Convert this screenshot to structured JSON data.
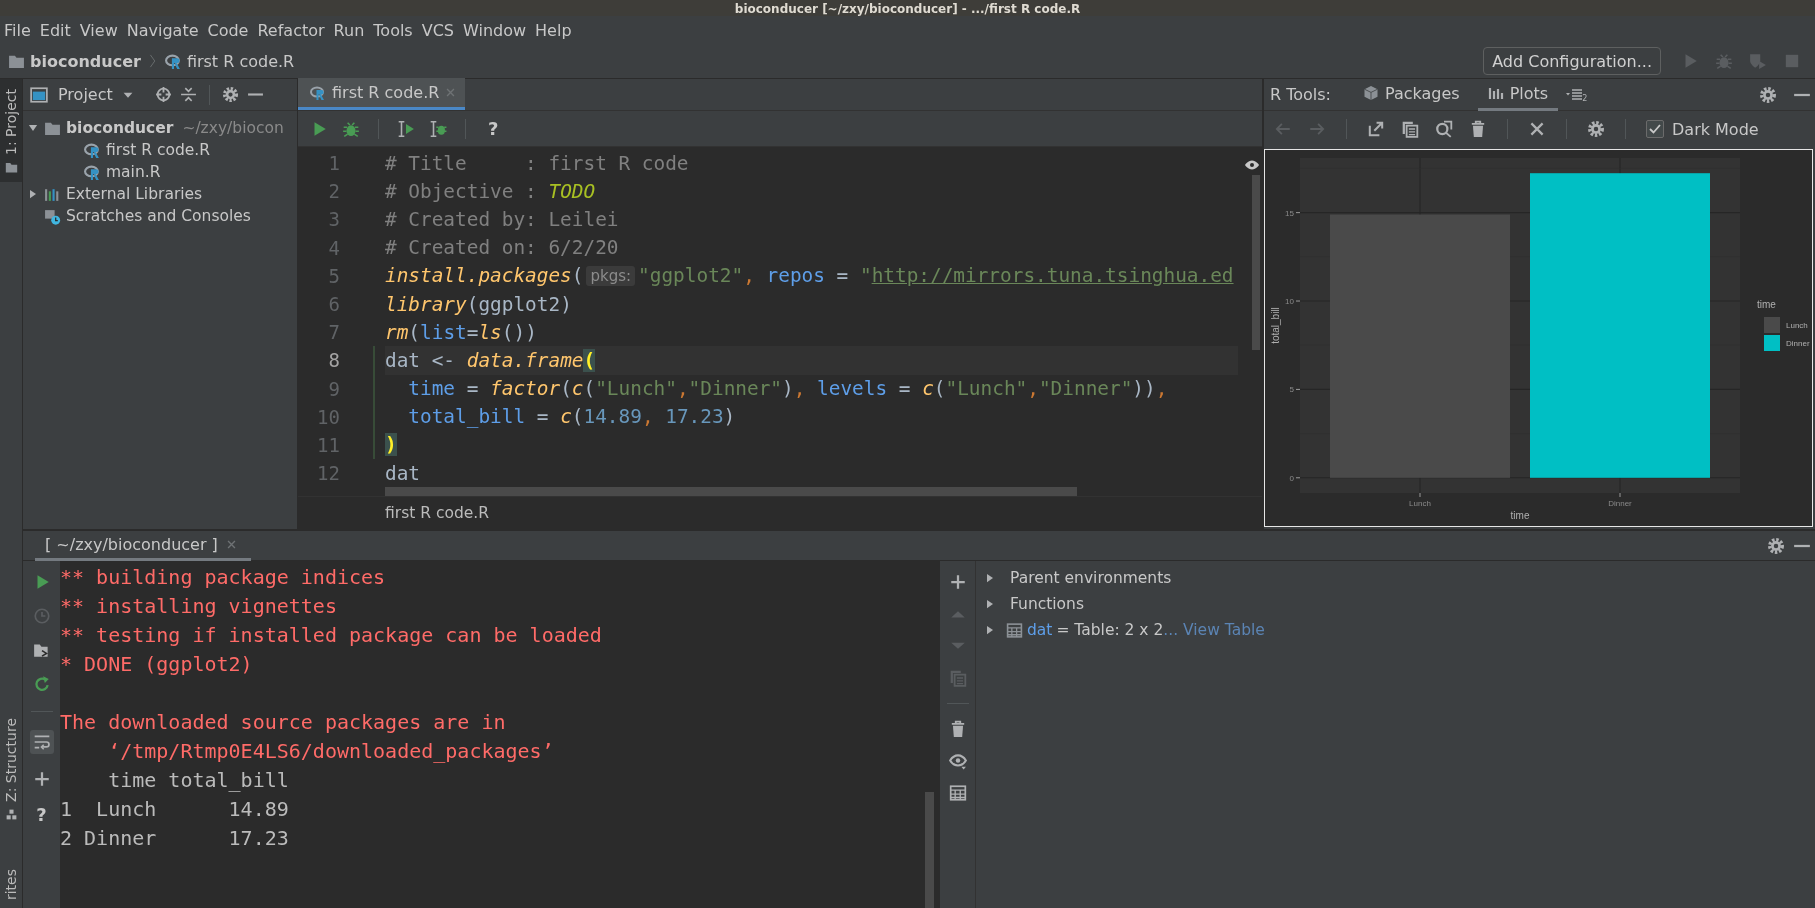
{
  "window": {
    "title": "bioconducer [~/zxy/bioconducer] - .../first R code.R"
  },
  "menu": [
    "File",
    "Edit",
    "View",
    "Navigate",
    "Code",
    "Refactor",
    "Run",
    "Tools",
    "VCS",
    "Window",
    "Help"
  ],
  "navigation": {
    "breadcrumbs": [
      {
        "kind": "folder",
        "label": "bioconducer"
      },
      {
        "kind": "r-file",
        "label": "first R code.R"
      }
    ],
    "run_config": "Add Configuration...",
    "actions": [
      {
        "kind": "run",
        "disabled": true
      },
      {
        "kind": "debug",
        "disabled": true
      },
      {
        "kind": "coverage",
        "disabled": true
      },
      {
        "kind": "stop",
        "disabled": true
      }
    ]
  },
  "left_strip": {
    "top": [
      {
        "label": "1: Project",
        "kind": "folder",
        "selected": true
      }
    ],
    "bottom": [
      {
        "label": "Z: Structure",
        "kind": "structure",
        "selected": false
      },
      {
        "label": "rites",
        "selected": false
      }
    ]
  },
  "project": {
    "title": "Project",
    "tree": [
      {
        "kind": "folder",
        "label": "bioconducer",
        "hint": "~/zxy/biocon",
        "expanded": true,
        "children": [
          {
            "kind": "r-file",
            "label": "first R code.R"
          },
          {
            "kind": "r-file",
            "label": "main.R"
          }
        ]
      },
      {
        "kind": "library",
        "label": "External Libraries",
        "expanded": false
      },
      {
        "kind": "scratch",
        "label": "Scratches and Consoles"
      }
    ]
  },
  "editor": {
    "tabs": [
      {
        "label": "first R code.R",
        "selected": true
      }
    ],
    "toolbar": [
      {
        "kind": "run"
      },
      {
        "kind": "debug"
      },
      {
        "kind": "run-selection"
      },
      {
        "kind": "debug-selection"
      },
      {
        "kind": "help",
        "glyph": "?"
      }
    ],
    "lines": [
      {
        "number": "1",
        "current": false,
        "changed": false,
        "tokens": [
          {
            "text": "# Title     : first R code",
            "kind": "comment"
          }
        ]
      },
      {
        "number": "2",
        "current": false,
        "changed": false,
        "tokens": [
          {
            "text": "# Objective : ",
            "kind": "comment"
          },
          {
            "text": "TODO",
            "kind": "todo"
          }
        ]
      },
      {
        "number": "3",
        "current": false,
        "changed": false,
        "tokens": [
          {
            "text": "# Created by: Leilei",
            "kind": "comment"
          }
        ]
      },
      {
        "number": "4",
        "current": false,
        "changed": false,
        "tokens": [
          {
            "text": "# Created on: 6/2/20",
            "kind": "comment"
          }
        ]
      },
      {
        "number": "5",
        "current": false,
        "changed": false,
        "tokens": [
          {
            "text": "install.packages",
            "kind": "fn"
          },
          {
            "text": "(",
            "kind": "plain"
          },
          {
            "text": "pkgs:",
            "kind": "hint"
          },
          {
            "text": "\"ggplot2\"",
            "kind": "str"
          },
          {
            "text": ", ",
            "kind": "comma"
          },
          {
            "text": "repos",
            "kind": "param"
          },
          {
            "text": " = ",
            "kind": "plain"
          },
          {
            "text": "\"",
            "kind": "str"
          },
          {
            "text": "http://mirrors.tuna.tsinghua.ed",
            "kind": "url"
          }
        ]
      },
      {
        "number": "6",
        "current": false,
        "changed": false,
        "tokens": [
          {
            "text": "library",
            "kind": "fn"
          },
          {
            "text": "(ggplot2)",
            "kind": "plain"
          }
        ]
      },
      {
        "number": "7",
        "current": false,
        "changed": false,
        "tokens": [
          {
            "text": "rm",
            "kind": "fn"
          },
          {
            "text": "(",
            "kind": "plain"
          },
          {
            "text": "list",
            "kind": "param"
          },
          {
            "text": "=",
            "kind": "plain"
          },
          {
            "text": "ls",
            "kind": "fn"
          },
          {
            "text": "())",
            "kind": "plain"
          }
        ]
      },
      {
        "number": "8",
        "current": true,
        "changed": true,
        "tokens": [
          {
            "text": "dat <- ",
            "kind": "plain"
          },
          {
            "text": "data.frame",
            "kind": "fn"
          },
          {
            "text": "(",
            "kind": "bracket"
          }
        ]
      },
      {
        "number": "9",
        "current": false,
        "changed": true,
        "tokens": [
          {
            "text": "  time",
            "kind": "param"
          },
          {
            "text": " = ",
            "kind": "plain"
          },
          {
            "text": "factor",
            "kind": "fn"
          },
          {
            "text": "(",
            "kind": "plain"
          },
          {
            "text": "c",
            "kind": "fn"
          },
          {
            "text": "(",
            "kind": "plain"
          },
          {
            "text": "\"Lunch\"",
            "kind": "str"
          },
          {
            "text": ",",
            "kind": "comma"
          },
          {
            "text": "\"Dinner\"",
            "kind": "str"
          },
          {
            "text": ")",
            "kind": "plain"
          },
          {
            "text": ", ",
            "kind": "comma"
          },
          {
            "text": "levels",
            "kind": "param"
          },
          {
            "text": " = ",
            "kind": "plain"
          },
          {
            "text": "c",
            "kind": "fn"
          },
          {
            "text": "(",
            "kind": "plain"
          },
          {
            "text": "\"Lunch\"",
            "kind": "str"
          },
          {
            "text": ",",
            "kind": "comma"
          },
          {
            "text": "\"Dinner\"",
            "kind": "str"
          },
          {
            "text": "))",
            "kind": "plain"
          },
          {
            "text": ",",
            "kind": "comma"
          }
        ]
      },
      {
        "number": "10",
        "current": false,
        "changed": true,
        "tokens": [
          {
            "text": "  total_bill",
            "kind": "param"
          },
          {
            "text": " = ",
            "kind": "plain"
          },
          {
            "text": "c",
            "kind": "fn"
          },
          {
            "text": "(",
            "kind": "plain"
          },
          {
            "text": "14.89",
            "kind": "num"
          },
          {
            "text": ", ",
            "kind": "comma"
          },
          {
            "text": "17.23",
            "kind": "num"
          },
          {
            "text": ")",
            "kind": "plain"
          }
        ]
      },
      {
        "number": "11",
        "current": false,
        "changed": true,
        "tokens": [
          {
            "text": ")",
            "kind": "bracket"
          }
        ]
      },
      {
        "number": "12",
        "current": false,
        "changed": false,
        "tokens": [
          {
            "text": "dat",
            "kind": "plain"
          }
        ]
      }
    ],
    "breadcrumb": "first R code.R"
  },
  "r_tools": {
    "label": "R Tools:",
    "tabs": [
      {
        "label": "Packages",
        "kind": "packages",
        "selected": false
      },
      {
        "label": "Plots",
        "kind": "plots",
        "selected": true
      }
    ],
    "history_count": "2",
    "toolbar": [
      {
        "kind": "back",
        "disabled": true
      },
      {
        "kind": "forward",
        "disabled": true
      },
      {
        "kind": "export",
        "disabled": false
      },
      {
        "kind": "copy",
        "disabled": false
      },
      {
        "kind": "zoom",
        "disabled": false
      },
      {
        "kind": "delete",
        "disabled": false
      },
      {
        "kind": "close",
        "disabled": false
      },
      {
        "kind": "settings",
        "disabled": false
      }
    ],
    "dark_mode": {
      "label": "Dark Mode",
      "checked": true
    },
    "plot": {
      "chart_data": {
        "type": "bar",
        "grid": true,
        "legend": {
          "title": "time"
        },
        "xlabel": "time",
        "ylabel": "total_bill",
        "categories": [
          "Lunch",
          "Dinner"
        ],
        "series": [
          {
            "name": "Lunch",
            "color": "#4a4a4a",
            "values": [
              14.89,
              null
            ]
          },
          {
            "name": "Dinner",
            "color": "#00bfc4",
            "values": [
              null,
              17.23
            ]
          }
        ],
        "ylim": [
          -0.86,
          18.09
        ],
        "yticks": [
          0,
          5,
          10,
          15
        ]
      }
    }
  },
  "console": {
    "tab": {
      "label": "[ ~/zxy/bioconducer ]",
      "selected": true
    },
    "toolbar": [
      {
        "kind": "run",
        "disabled": false,
        "on": false
      },
      {
        "kind": "history",
        "disabled": true,
        "on": false
      },
      {
        "kind": "import",
        "disabled": false,
        "on": false
      },
      {
        "kind": "rerun",
        "disabled": false,
        "on": false
      },
      {
        "kind": "soft-wrap",
        "disabled": false,
        "on": true
      },
      {
        "kind": "add",
        "disabled": false,
        "on": false
      },
      {
        "kind": "help",
        "glyph": "?",
        "disabled": false,
        "on": false
      }
    ],
    "lines": [
      {
        "text": "** building package indices",
        "kind": "stderr",
        "gap_before": false
      },
      {
        "text": "** installing vignettes",
        "kind": "stderr",
        "gap_before": false
      },
      {
        "text": "** testing if installed package can be loaded",
        "kind": "stderr",
        "gap_before": false
      },
      {
        "text": "* DONE (ggplot2)",
        "kind": "stderr",
        "gap_before": false
      },
      {
        "text": "The downloaded source packages are in",
        "kind": "stderr",
        "gap_before": true
      },
      {
        "text": "    ‘/tmp/Rtmp0E4LS6/downloaded_packages’",
        "kind": "stderr",
        "gap_before": false
      },
      {
        "text": "    time total_bill",
        "kind": "stdout",
        "gap_before": false
      },
      {
        "text": "1  Lunch      14.89",
        "kind": "stdout",
        "gap_before": false
      },
      {
        "text": "2 Dinner      17.23",
        "kind": "stdout",
        "gap_before": false
      }
    ]
  },
  "variables": {
    "toolbar": [
      {
        "kind": "add",
        "disabled": false
      },
      {
        "kind": "up",
        "disabled": true
      },
      {
        "kind": "down",
        "disabled": true
      },
      {
        "kind": "copy",
        "disabled": true
      },
      {
        "kind": "delete",
        "disabled": false
      },
      {
        "kind": "watch",
        "disabled": false
      },
      {
        "kind": "table",
        "disabled": false
      }
    ],
    "items": [
      {
        "kind": "group",
        "label": "Parent environments",
        "expanded": false
      },
      {
        "kind": "group",
        "label": "Functions",
        "expanded": false
      },
      {
        "kind": "table",
        "name": "dat",
        "value": "= Table: 2 x 2",
        "link": "... View Table",
        "expanded": false
      }
    ]
  }
}
